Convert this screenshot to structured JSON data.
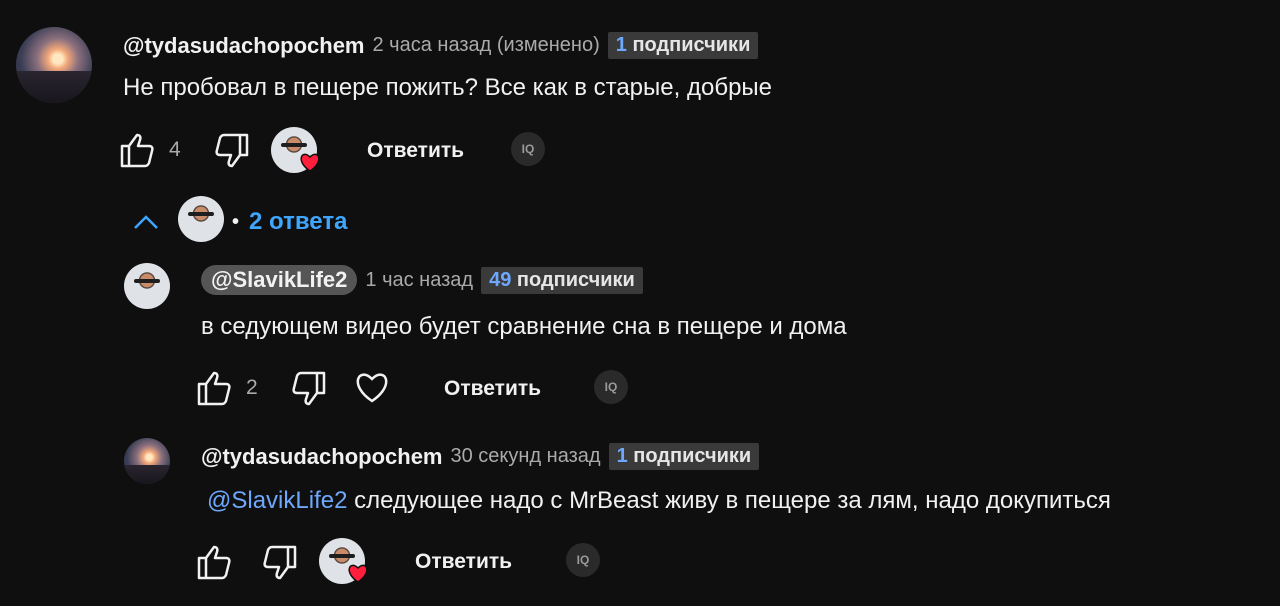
{
  "comments": [
    {
      "author": "@tydasudachopochem",
      "time": "2 часа назад (изменено)",
      "subs_num": "1",
      "subs_label": "подписчики",
      "text": "Не пробовал в пещере пожить? Все как в старые, добрые",
      "likes": "4",
      "reply_label": "Ответить",
      "iq_label": "IQ"
    }
  ],
  "replies_toggle": {
    "dot": "•",
    "label": "2 ответа"
  },
  "replies": [
    {
      "author": "@SlavikLife2",
      "time": "1 час назад",
      "subs_num": "49",
      "subs_label": "подписчики",
      "text": "в седующем видео будет сравнение сна в пещере и дома",
      "likes": "2",
      "reply_label": "Ответить",
      "iq_label": "IQ"
    },
    {
      "author": "@tydasudachopochem",
      "time": "30 секунд назад",
      "subs_num": "1",
      "subs_label": "подписчики",
      "mention": "@SlavikLife2",
      "text": " следующее надо с MrBeast живу в пещере за лям, надо докупиться",
      "reply_label": "Ответить",
      "iq_label": "IQ"
    }
  ],
  "colors": {
    "background": "#0f0f0f",
    "link": "#3ea6ff",
    "heart": "#ff1f3d"
  }
}
